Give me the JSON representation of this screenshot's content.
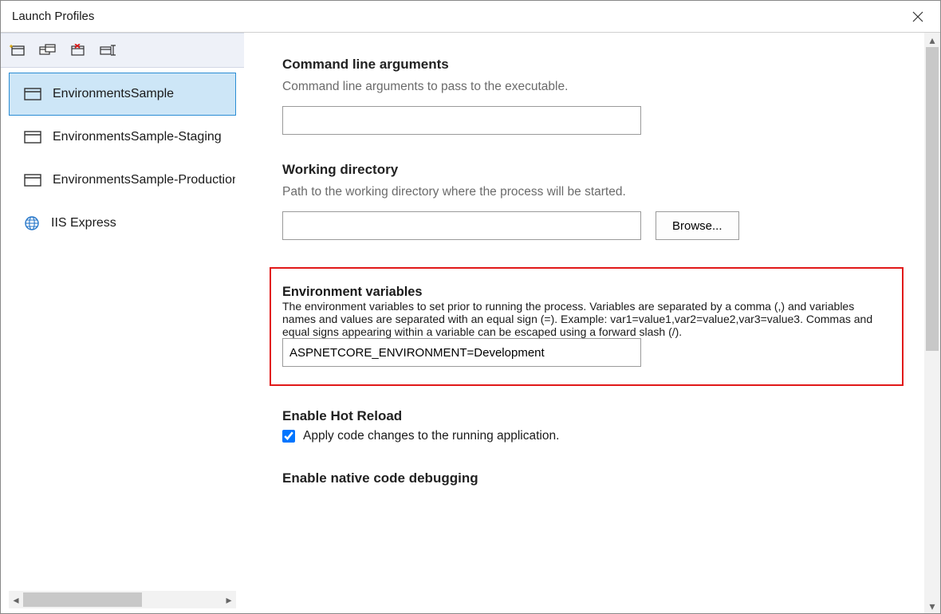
{
  "window": {
    "title": "Launch Profiles"
  },
  "toolbar": {
    "buttons": [
      "new-profile",
      "duplicate-profile",
      "delete-profile",
      "rename-profile"
    ]
  },
  "profiles": [
    {
      "label": "EnvironmentsSample",
      "icon": "window",
      "selected": true
    },
    {
      "label": "EnvironmentsSample-Staging",
      "icon": "window",
      "selected": false
    },
    {
      "label": "EnvironmentsSample-Production",
      "icon": "window",
      "selected": false
    },
    {
      "label": "IIS Express",
      "icon": "globe",
      "selected": false
    }
  ],
  "sections": {
    "cli": {
      "title": "Command line arguments",
      "desc": "Command line arguments to pass to the executable.",
      "value": ""
    },
    "workdir": {
      "title": "Working directory",
      "desc": "Path to the working directory where the process will be started.",
      "value": "",
      "browse_label": "Browse..."
    },
    "envvars": {
      "title": "Environment variables",
      "desc": "The environment variables to set prior to running the process. Variables are separated by a comma (,) and variables names and values are separated with an equal sign (=). Example: var1=value1,var2=value2,var3=value3. Commas and equal signs appearing within a variable can be escaped using a forward slash (/).",
      "value": "ASPNETCORE_ENVIRONMENT=Development"
    },
    "hotreload": {
      "title": "Enable Hot Reload",
      "checkbox_label": "Apply code changes to the running application.",
      "checked": true
    },
    "nativedebug": {
      "title": "Enable native code debugging"
    }
  }
}
